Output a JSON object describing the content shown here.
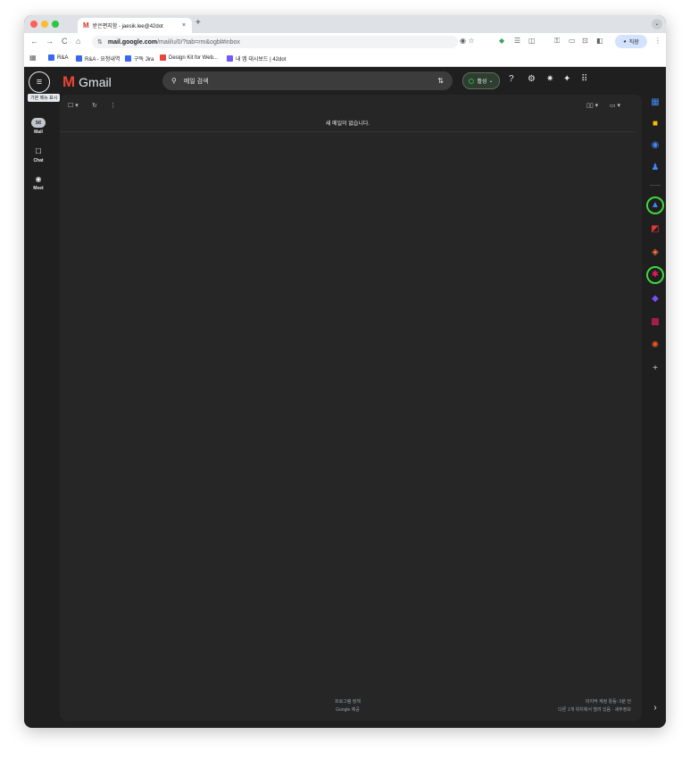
{
  "browser": {
    "tab_title": "받은편지함 - jaesik.lee@42dot",
    "tab_close": "×",
    "new_tab": "+",
    "tab_menu": "⌄",
    "nav": {
      "back": "←",
      "forward": "→",
      "reload": "C",
      "home": "⌂"
    },
    "url_host": "mail.google.com",
    "url_path": "/mail/u/0/?tab=rm&ogbl#inbox",
    "omnibox_icons": "◉  ☆",
    "profile_label": "직장",
    "menu": "⋮",
    "bookmarks": [
      {
        "label": "R&A",
        "color": "#3867f5"
      },
      {
        "label": "R&A - 요청내역",
        "color": "#3867f5"
      },
      {
        "label": "구독 Jira",
        "color": "#3867f5"
      },
      {
        "label": "Design Kit for Web...",
        "color": "#e8453c"
      },
      {
        "label": "내 앱 대시보드 | 42dot",
        "color": "#6a5cff"
      }
    ]
  },
  "gmail": {
    "menu_icon": "≡",
    "menu_tooltip": "기본 메뉴 표시",
    "logo_text": "Gmail",
    "search_placeholder": "메일 검색",
    "status_label": "활성",
    "nav": [
      {
        "label": "Mail",
        "icon": "✉"
      },
      {
        "label": "Chat",
        "icon": "☐"
      },
      {
        "label": "Meet",
        "icon": "◉"
      }
    ],
    "toolbar": {
      "select": "☐ ▾",
      "refresh": "↻",
      "more": "⋮",
      "view": "▯▯ ▾",
      "density": "▭ ▾"
    },
    "empty_message": "새 메일이 없습니다.",
    "footer_center": [
      "프로그램 정책",
      "Google 제공"
    ],
    "footer_right": [
      "마지막 계정 활동: 0분 전",
      "다른 1개 위치에서 열려 있음 · 세부정보"
    ],
    "side_add": "+",
    "side_collapse": "›"
  },
  "colors": {
    "background": "#1f1f1f",
    "panel": "#262626",
    "highlight_ring": "#3dd93d",
    "gmail_red": "#ea4335"
  }
}
